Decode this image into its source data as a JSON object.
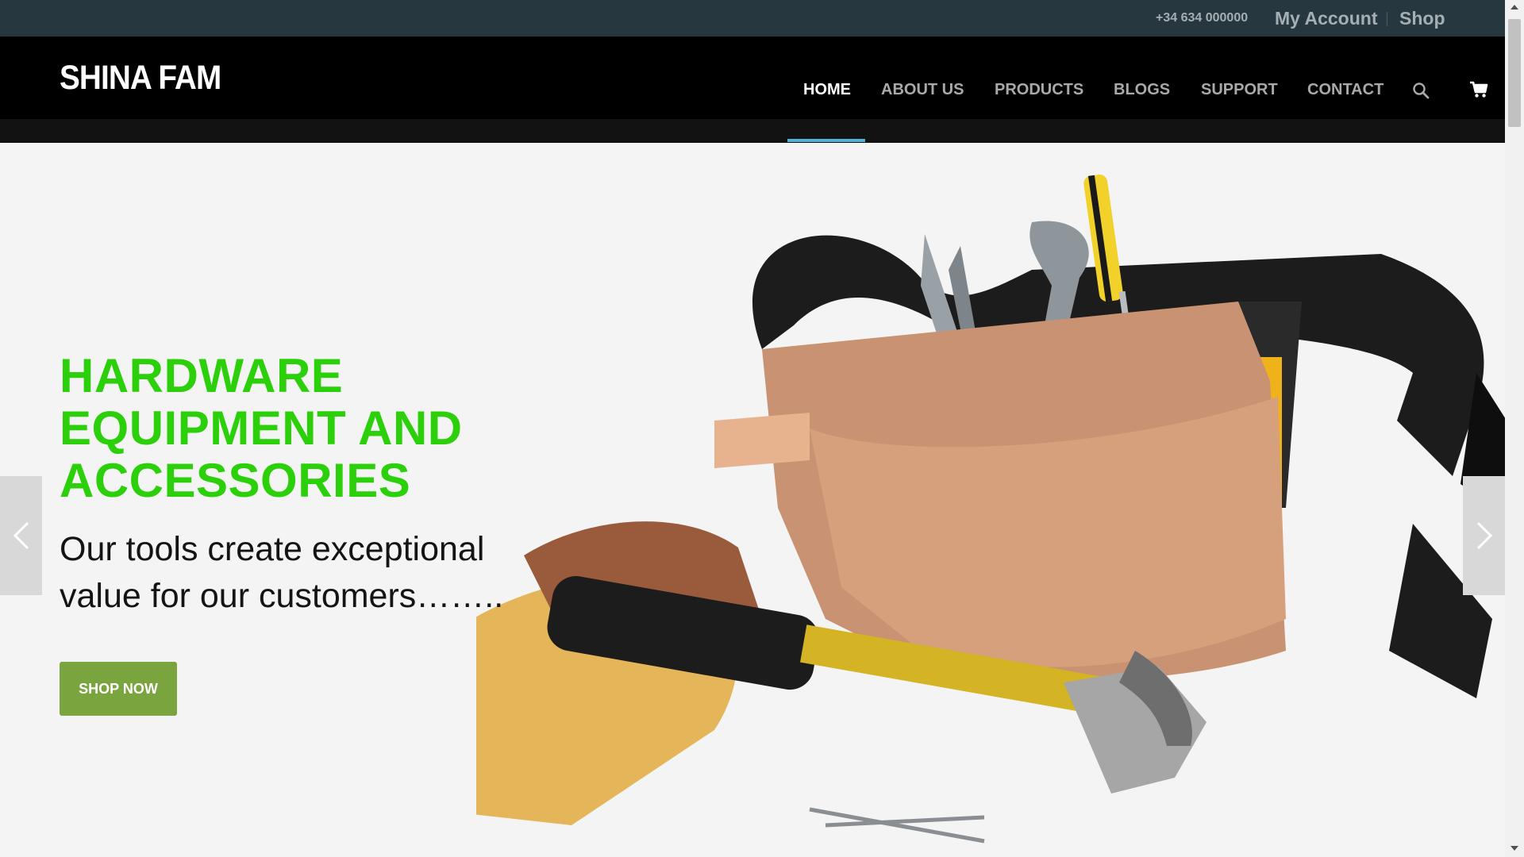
{
  "topbar": {
    "phone": "+34 634 000000",
    "my_account": "My Account",
    "shop": "Shop"
  },
  "header": {
    "logo": "SHINA FAM",
    "nav": [
      {
        "label": "HOME",
        "active": true
      },
      {
        "label": "ABOUT US"
      },
      {
        "label": "PRODUCTS"
      },
      {
        "label": "BLOGS"
      },
      {
        "label": "SUPPORT"
      },
      {
        "label": "CONTACT"
      }
    ],
    "icons": [
      "search-icon",
      "cart-icon"
    ]
  },
  "hero": {
    "title": "HARDWARE EQUIPMENT AND ACCESSORIES",
    "subtitle": "Our tools create exceptional value for our customers……..",
    "button": "SHOP NOW",
    "image": "tool-belt-with-tools-gloves-hammer"
  },
  "colors": {
    "topbar_bg": "#263740",
    "header_bg": "#000000",
    "title_green": "#2cd00a",
    "button_green": "#7aa43e",
    "nav_underline": "#4fb4d8"
  }
}
